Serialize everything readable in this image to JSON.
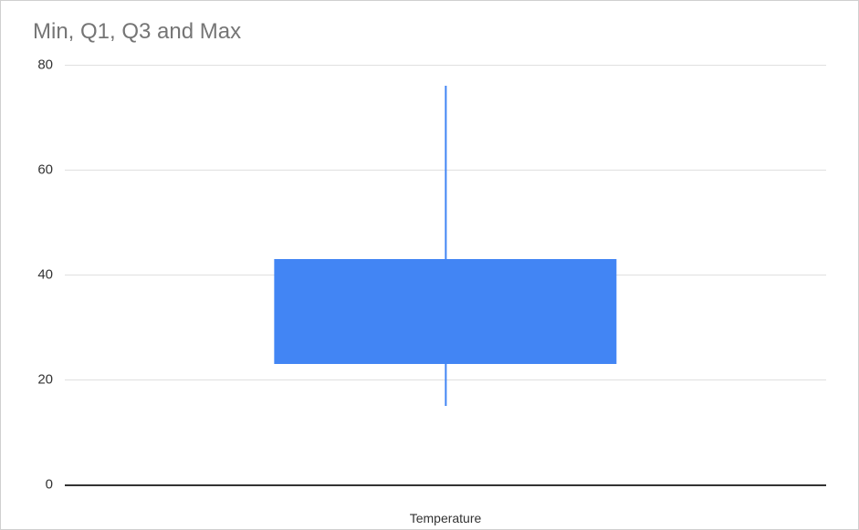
{
  "chart_data": {
    "type": "boxplot",
    "title": "Min, Q1, Q3 and Max",
    "categories": [
      "Temperature"
    ],
    "series": [
      {
        "name": "Temperature",
        "min": 15,
        "q1": 23,
        "q3": 43,
        "max": 76
      }
    ],
    "ylabel": "",
    "xlabel": "",
    "ylim": [
      0,
      80
    ],
    "y_ticks": [
      0,
      20,
      40,
      60,
      80
    ],
    "box_color": "#4285f4",
    "whisker_color": "#4285f4"
  }
}
